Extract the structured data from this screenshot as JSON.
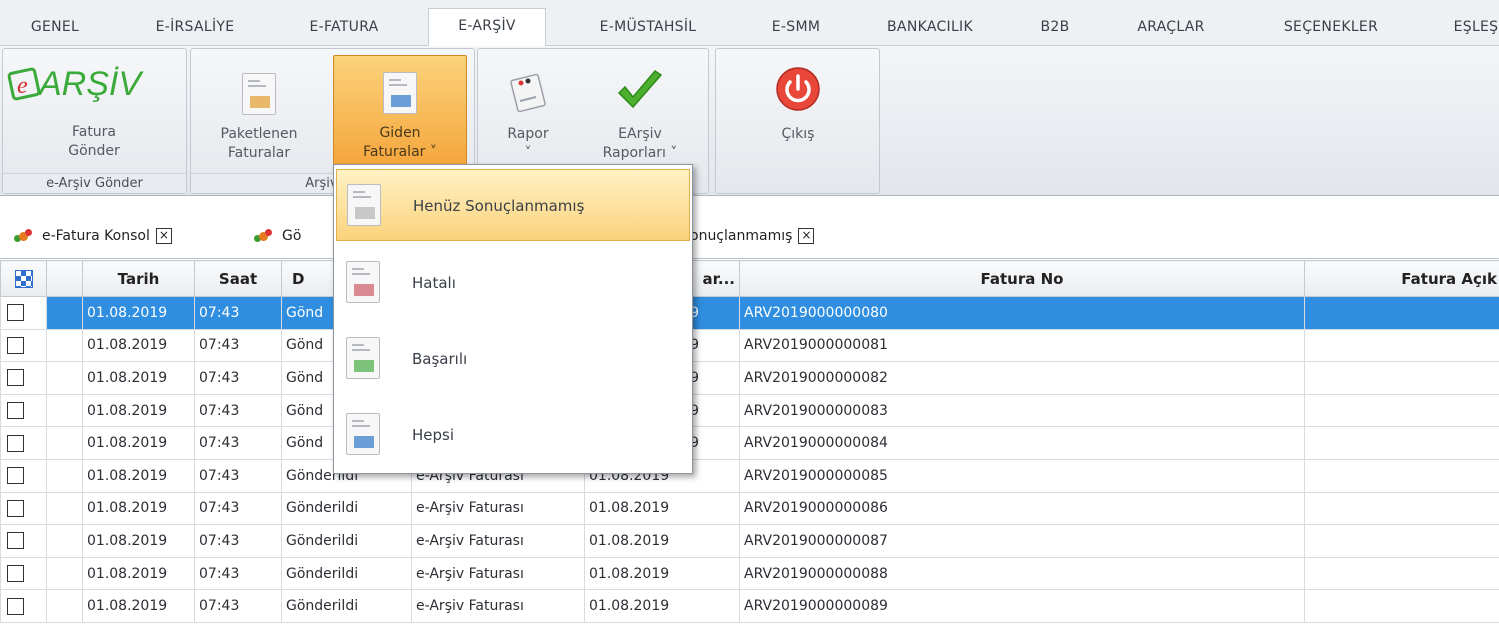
{
  "menu_tabs": [
    "GENEL",
    "E-İRSALİYE",
    "E-FATURA",
    "E-ARŞİV",
    "E-MÜSTAHSİL",
    "E-SMM",
    "BANKACILIK",
    "B2B",
    "ARAÇLAR",
    "SEÇENEKLER",
    "EŞLEŞ"
  ],
  "ribbon": {
    "logo_text": "ARŞİV",
    "logo_prefix": "e",
    "fatura_gonder": [
      "Fatura",
      "Gönder"
    ],
    "group1_label": "e-Arşiv Gönder",
    "paketlenen": [
      "Paketlenen",
      "Faturalar"
    ],
    "giden": [
      "Giden",
      "Faturalar ˅"
    ],
    "group2_label": "Arşive G",
    "rapor": [
      "Rapor",
      "˅"
    ],
    "earsiv_raporlari": [
      "EArşiv",
      "Raporları ˅"
    ],
    "cikis": "Çıkış"
  },
  "content_tabs": {
    "tab1": "e-Fatura Konsol",
    "tab2_partial": "Gö",
    "tab3_partial": "onuçlanmamış",
    "close": "×"
  },
  "grid": {
    "headers": {
      "tarih": "Tarih",
      "saat": "Saat",
      "durum": "D",
      "tur": "",
      "fatura_tarihi": "ar...",
      "fatura_no": "Fatura No",
      "fatura_aciklama": "Fatura Açık"
    },
    "rows": [
      {
        "tarih": "01.08.2019",
        "saat": "07:43",
        "durum": "Gönd",
        "tur": "",
        "ftarih": "9",
        "no": "ARV2019000000080"
      },
      {
        "tarih": "01.08.2019",
        "saat": "07:43",
        "durum": "Gönd",
        "tur": "",
        "ftarih": "9",
        "no": "ARV2019000000081"
      },
      {
        "tarih": "01.08.2019",
        "saat": "07:43",
        "durum": "Gönd",
        "tur": "",
        "ftarih": "9",
        "no": "ARV2019000000082"
      },
      {
        "tarih": "01.08.2019",
        "saat": "07:43",
        "durum": "Gönd",
        "tur": "",
        "ftarih": "9",
        "no": "ARV2019000000083"
      },
      {
        "tarih": "01.08.2019",
        "saat": "07:43",
        "durum": "Gönd",
        "tur": "",
        "ftarih": "9",
        "no": "ARV2019000000084"
      },
      {
        "tarih": "01.08.2019",
        "saat": "07:43",
        "durum": "Gönderildi",
        "tur": "e-Arşiv Faturası",
        "ftarih": "01.08.2019",
        "no": "ARV2019000000085"
      },
      {
        "tarih": "01.08.2019",
        "saat": "07:43",
        "durum": "Gönderildi",
        "tur": "e-Arşiv Faturası",
        "ftarih": "01.08.2019",
        "no": "ARV2019000000086"
      },
      {
        "tarih": "01.08.2019",
        "saat": "07:43",
        "durum": "Gönderildi",
        "tur": "e-Arşiv Faturası",
        "ftarih": "01.08.2019",
        "no": "ARV2019000000087"
      },
      {
        "tarih": "01.08.2019",
        "saat": "07:43",
        "durum": "Gönderildi",
        "tur": "e-Arşiv Faturası",
        "ftarih": "01.08.2019",
        "no": "ARV2019000000088"
      },
      {
        "tarih": "01.08.2019",
        "saat": "07:43",
        "durum": "Gönderildi",
        "tur": "e-Arşiv Faturası",
        "ftarih": "01.08.2019",
        "no": "ARV2019000000089"
      }
    ]
  },
  "dropdown": {
    "items": [
      "Henüz Sonuçlanmamış",
      "Hatalı",
      "Başarılı",
      "Hepsi"
    ]
  },
  "colors": {
    "accent_orange": "#f5a33a",
    "selection_blue": "#2f8ee0",
    "checkmark_green": "#4caf2e",
    "power_red": "#e8473a"
  }
}
